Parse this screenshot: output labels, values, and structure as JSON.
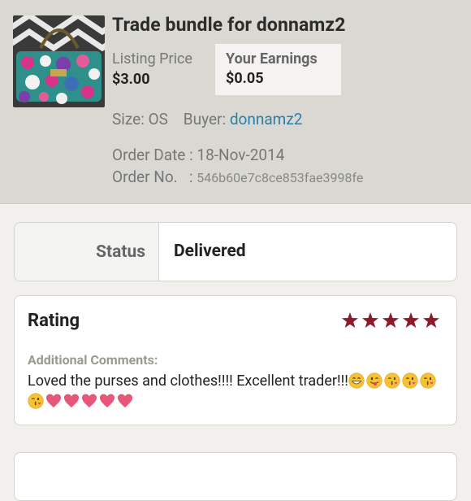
{
  "listing": {
    "title": "Trade bundle for donnamz2",
    "price_label": "Listing Price",
    "price_value": "$3.00",
    "earnings_label": "Your Earnings",
    "earnings_value": "$0.05",
    "size_label": "Size:",
    "size_value": "OS",
    "buyer_label": "Buyer:",
    "buyer_value": "donnamz2",
    "order_date_label": "Order Date :",
    "order_date_value": "18-Nov-2014",
    "order_no_label": "Order No.",
    "order_no_sep": ":",
    "order_no_value": "546b60e7c8ce853fae3998fe"
  },
  "status": {
    "label": "Status",
    "value": "Delivered"
  },
  "rating": {
    "title": "Rating",
    "stars": 5,
    "max_stars": 5,
    "star_color": "#8b1a2b",
    "comments_label": "Additional Comments:",
    "comments_text": "Loved the purses and clothes!!!! Excellent trader!!!",
    "emojis_line1": [
      "grin-face-emoji",
      "wink-tongue-face-emoji",
      "kiss-face-emoji",
      "kiss-face-emoji",
      "kiss-face-emoji"
    ],
    "emojis_line2": [
      "kiss-face-emoji",
      "heart-emoji",
      "heart-emoji",
      "heart-emoji",
      "heart-emoji",
      "heart-emoji"
    ]
  },
  "colors": {
    "link": "#2a7fa8",
    "header_bg": "#d9d8d2",
    "page_bg": "#f1f0ec"
  }
}
